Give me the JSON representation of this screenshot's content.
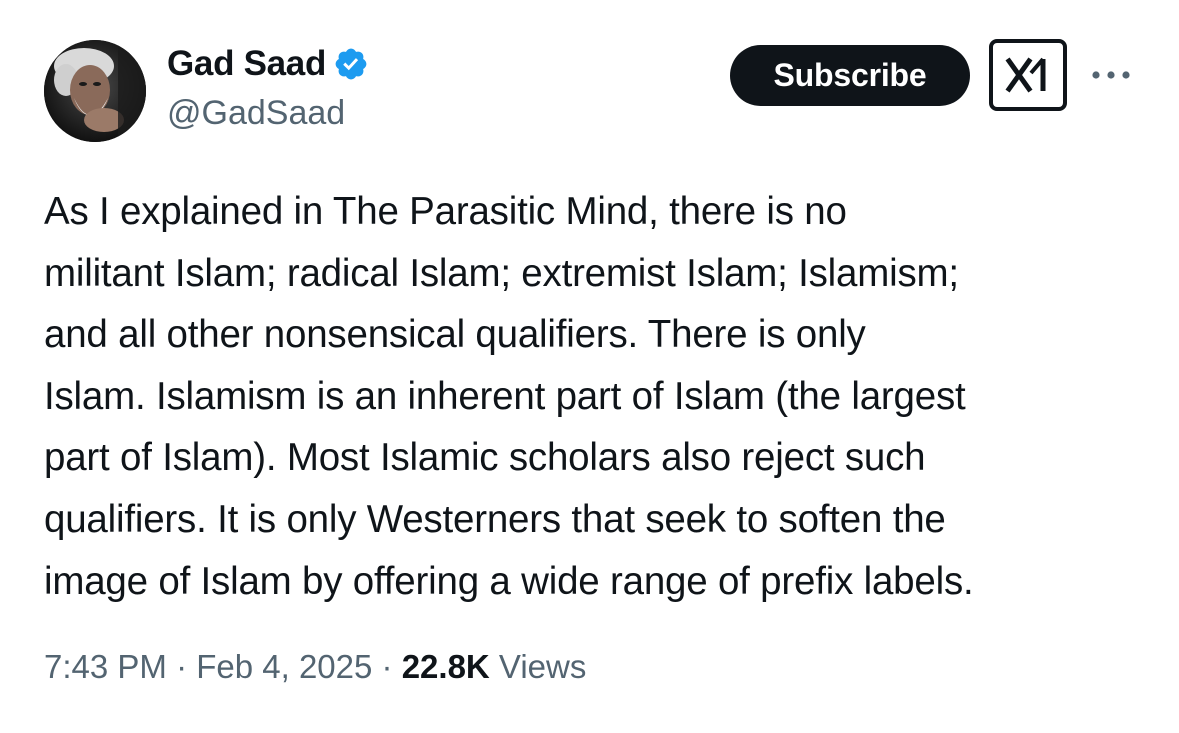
{
  "author": {
    "name": "Gad Saad",
    "handle": "@GadSaad",
    "verified": true,
    "verified_badge_color": "#1d9bf0",
    "avatar_icon": "profile-photo"
  },
  "actions": {
    "subscribe_label": "Subscribe",
    "grok_icon": "grok-icon",
    "more_icon": "more-options-icon"
  },
  "tweet": {
    "text": "As I explained in The Parasitic Mind, there is no\nmilitant Islam; radical Islam; extremist Islam; Islamism;\nand all other nonsensical qualifiers.  There is only\nIslam.  Islamism is an inherent part of Islam (the largest\npart of Islam).  Most Islamic scholars also reject such\nqualifiers.  It is only Westerners that seek to soften the\nimage of Islam by offering a wide range of prefix labels."
  },
  "meta": {
    "time": "7:43 PM",
    "separator": " · ",
    "date": "Feb 4, 2025",
    "views_count": "22.8K",
    "views_label": " Views"
  },
  "colors": {
    "text_primary": "#0f1419",
    "text_secondary": "#536471",
    "button_bg": "#0f1419"
  }
}
